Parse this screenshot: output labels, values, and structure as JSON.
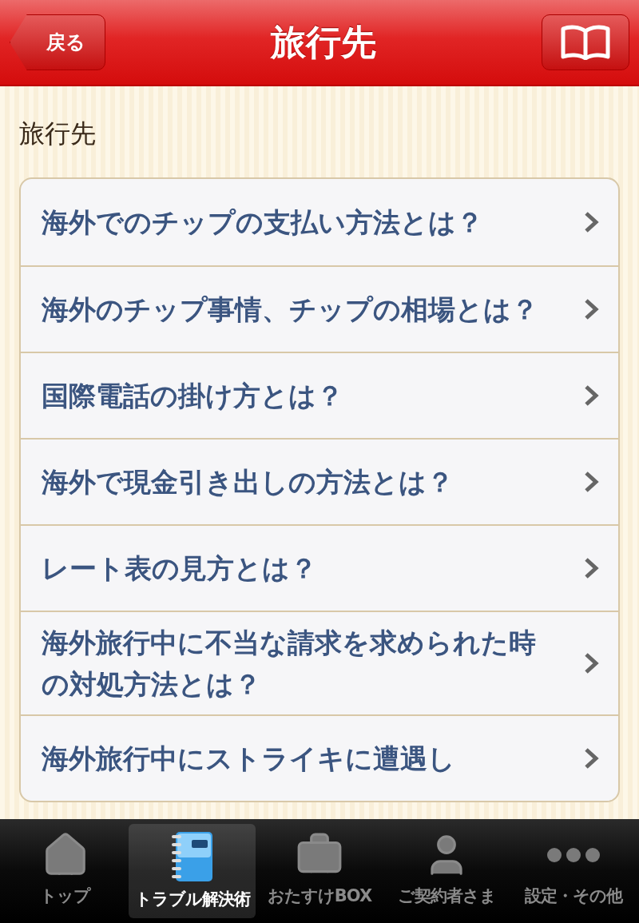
{
  "nav": {
    "back": "戻る",
    "title": "旅行先"
  },
  "section": {
    "title": "旅行先"
  },
  "items": [
    {
      "text": "海外でのチップの支払い方法とは？"
    },
    {
      "text": "海外のチップ事情、チップの相場とは？"
    },
    {
      "text": "国際電話の掛け方とは？"
    },
    {
      "text": "海外で現金引き出しの方法とは？"
    },
    {
      "text": "レート表の見方とは？"
    },
    {
      "text": "海外旅行中に不当な請求を求められた時の対処方法とは？"
    },
    {
      "text": "海外旅行中にストライキに遭遇し"
    }
  ],
  "tabs": [
    {
      "kind": "home",
      "label": "トップ",
      "selected": false
    },
    {
      "kind": "notebook",
      "label": "トラブル解決術",
      "selected": true
    },
    {
      "kind": "briefcase",
      "label": "おたすけBOX",
      "selected": false
    },
    {
      "kind": "person",
      "label": "ご契約者さま",
      "selected": false
    },
    {
      "kind": "more",
      "label": "設定・その他",
      "selected": false
    }
  ]
}
